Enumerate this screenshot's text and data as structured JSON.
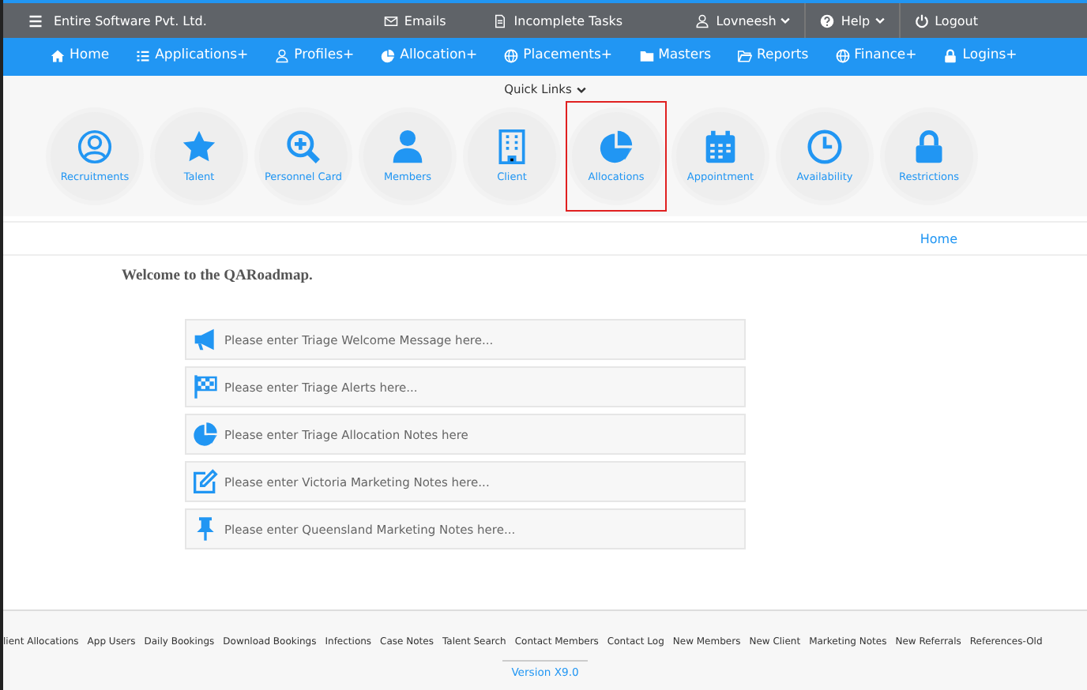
{
  "top_bar": {
    "brand": "Entire Software Pvt. Ltd.",
    "center_links": [
      {
        "label": "Emails",
        "kind": "envelope"
      },
      {
        "label": "Incomplete Tasks",
        "kind": "document"
      }
    ],
    "right_links": [
      {
        "label": "Lovneesh",
        "kind": "user",
        "dropdown": true
      },
      {
        "label": "Help",
        "kind": "question",
        "dropdown": true
      },
      {
        "label": "Logout",
        "kind": "power",
        "dropdown": false
      }
    ]
  },
  "nav": [
    {
      "label": "Home",
      "kind": "home"
    },
    {
      "label": "Applications+",
      "kind": "list"
    },
    {
      "label": "Profiles+",
      "kind": "user"
    },
    {
      "label": "Allocation+",
      "kind": "pie"
    },
    {
      "label": "Placements+",
      "kind": "globe"
    },
    {
      "label": "Masters",
      "kind": "folder"
    },
    {
      "label": "Reports",
      "kind": "folder-open"
    },
    {
      "label": "Finance+",
      "kind": "globe"
    },
    {
      "label": "Logins+",
      "kind": "lock"
    }
  ],
  "quick_links": {
    "title": "Quick Links",
    "items": [
      {
        "label": "Recruitments",
        "kind": "user-circle",
        "selected": false
      },
      {
        "label": "Talent",
        "kind": "star",
        "selected": false
      },
      {
        "label": "Personnel Card",
        "kind": "zoom",
        "selected": false
      },
      {
        "label": "Members",
        "kind": "person",
        "selected": false
      },
      {
        "label": "Client",
        "kind": "building",
        "selected": false
      },
      {
        "label": "Allocations",
        "kind": "pie",
        "selected": true
      },
      {
        "label": "Appointment",
        "kind": "calendar",
        "selected": false
      },
      {
        "label": "Availability",
        "kind": "clock",
        "selected": false
      },
      {
        "label": "Restrictions",
        "kind": "lock",
        "selected": false
      }
    ]
  },
  "breadcrumb": "Home",
  "welcome": "Welcome to the QARoadmap.",
  "notices": [
    {
      "placeholder": "Please enter Triage Welcome Message here...",
      "kind": "megaphone"
    },
    {
      "placeholder": "Please enter Triage Alerts here...",
      "kind": "flag"
    },
    {
      "placeholder": "Please enter Triage Allocation Notes here",
      "kind": "pie"
    },
    {
      "placeholder": "Please enter Victoria Marketing Notes here...",
      "kind": "edit"
    },
    {
      "placeholder": "Please enter Queensland Marketing Notes here...",
      "kind": "pin"
    }
  ],
  "footer_links": [
    "lient Allocations",
    "App Users",
    "Daily Bookings",
    "Download Bookings",
    "Infections",
    "Case Notes",
    "Talent Search",
    "Contact Members",
    "Contact Log",
    "New Members",
    "New Client",
    "Marketing Notes",
    "New Referrals",
    "References-Old"
  ],
  "version": "Version X9.0"
}
